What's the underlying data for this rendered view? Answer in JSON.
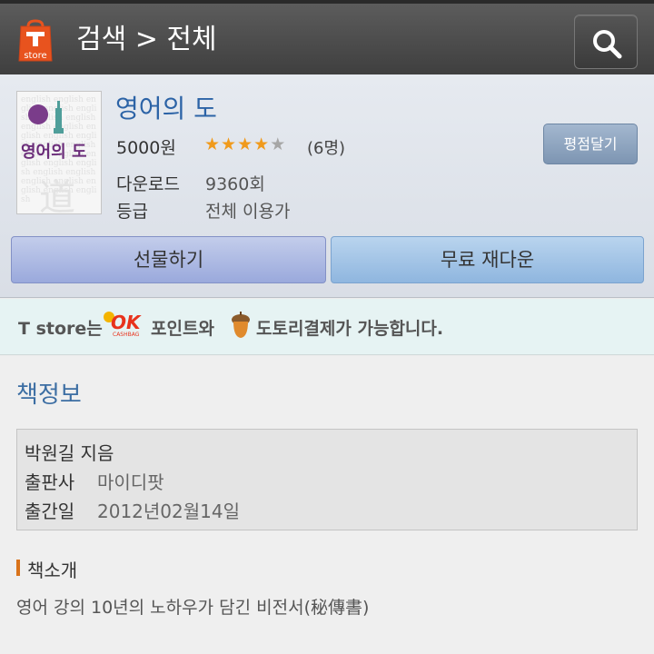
{
  "header": {
    "logo_text": "store",
    "title": "검색 > 전체"
  },
  "app": {
    "title": "영어의 도",
    "price": "5000원",
    "rating": 4,
    "rating_max": 5,
    "rating_count": "(6명)",
    "review_button": "평점달기",
    "downloads_label": "다운로드",
    "downloads_value": "9360회",
    "grade_label": "등급",
    "grade_value": "전체 이용가",
    "cover": {
      "title": "영어의 도",
      "bg_char": "道"
    },
    "gift_button": "선물하기",
    "download_button": "무료 재다운"
  },
  "promo": {
    "prefix": "T store는",
    "ok_logo": "OK",
    "ok_caption": "CASHBAG",
    "middle": "포인트와",
    "suffix": "도토리결제가 가능합니다."
  },
  "book_info": {
    "section_title": "책정보",
    "author": "박원길 지음",
    "publisher_label": "출판사",
    "publisher_value": "마이디팟",
    "date_label": "출간일",
    "date_value": "2012년02월14일",
    "intro_title": "책소개",
    "intro_text": "영어 강의 10년의 노하우가 담긴 비전서(秘傳書)"
  },
  "colors": {
    "accent_blue": "#2c63a6",
    "star": "#f09a1c",
    "header_bg": "#4a4a4a"
  },
  "icons": [
    "tstore-logo-icon",
    "search-icon",
    "star-icon",
    "ok-cashbag-icon",
    "acorn-icon"
  ]
}
